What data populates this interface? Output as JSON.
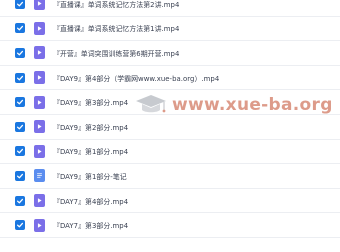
{
  "files": [
    {
      "name": "『直播课』单词系统记忆方法第2讲.mp4",
      "type": "video",
      "selected": true
    },
    {
      "name": "『直播课』单词系统记忆方法第1讲.mp4",
      "type": "video",
      "selected": true
    },
    {
      "name": "『开营』单词突围训练营第6期开营.mp4",
      "type": "video",
      "selected": true
    },
    {
      "name": "『DAY9』第4部分（学霸网www.xue-ba.org）.mp4",
      "type": "video",
      "selected": true
    },
    {
      "name": "『DAY9』第3部分.mp4",
      "type": "video",
      "selected": true
    },
    {
      "name": "『DAY9』第2部分.mp4",
      "type": "video",
      "selected": true
    },
    {
      "name": "『DAY9』第1部分.mp4",
      "type": "video",
      "selected": true
    },
    {
      "name": "『DAY9』第1部分-笔记",
      "type": "note",
      "selected": true
    },
    {
      "name": "『DAY7』第4部分.mp4",
      "type": "video",
      "selected": true
    },
    {
      "name": "『DAY7』第3部分.mp4",
      "type": "video",
      "selected": true
    }
  ],
  "watermark": {
    "text": "www.xue-ba.org",
    "icon": "graduation-cap-icon",
    "color": "#c24b2c"
  },
  "colors": {
    "checkbox": "#1a77e0",
    "video_icon": "#7b6fe8",
    "note_icon": "#5b8def",
    "text": "#3a4152"
  }
}
